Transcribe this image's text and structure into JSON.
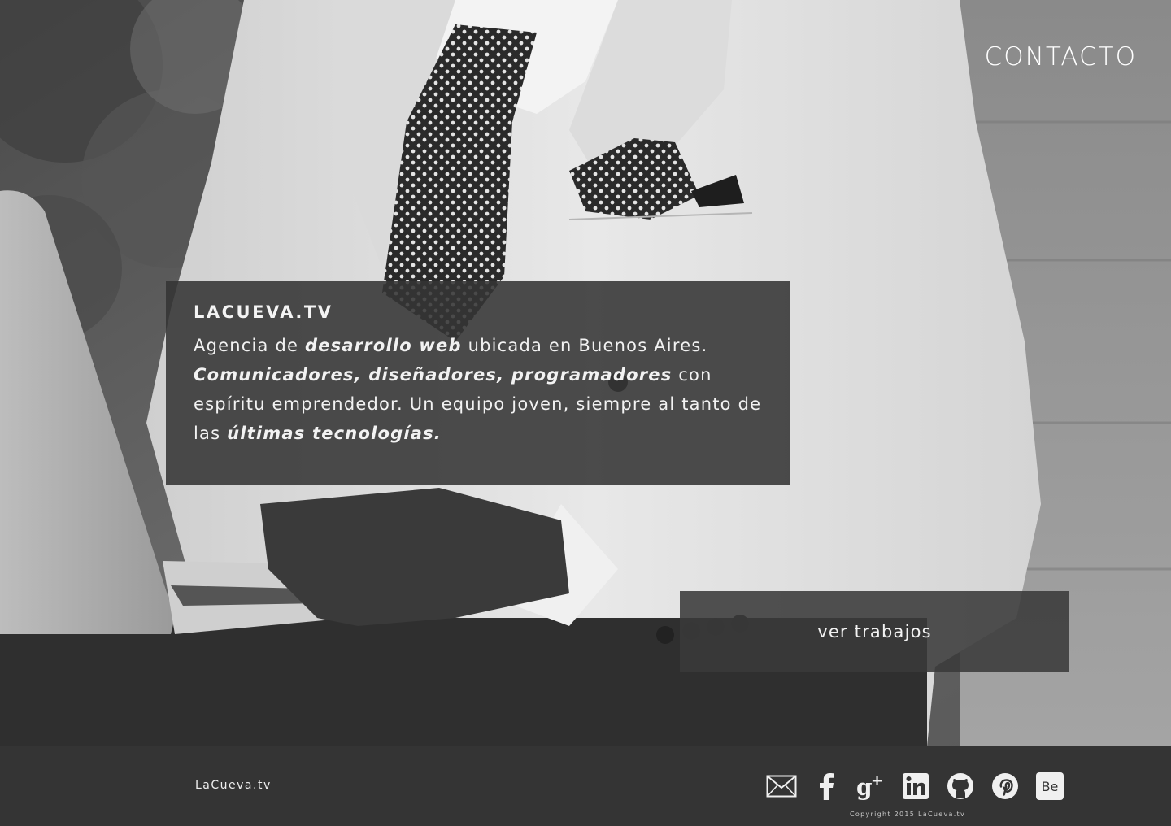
{
  "header": {
    "contact_label": "CONTACTO"
  },
  "about": {
    "brand": "LACUEVA.TV",
    "text_1": "Agencia de ",
    "bold_1": "desarrollo web",
    "text_2": " ubicada en Buenos Aires. ",
    "bold_2": "Comunicadores, diseñadores, programadores",
    "text_3": " con espíritu emprendedor. Un equipo joven, siempre al tanto de las ",
    "bold_3": "últimas tecnologías."
  },
  "cta": {
    "label": "ver trabajos"
  },
  "footer": {
    "brand": "LaCueva.tv",
    "copyright": "Copyright 2015  LaCueva.tv",
    "social": [
      {
        "icon": "mail-icon"
      },
      {
        "icon": "facebook-icon"
      },
      {
        "icon": "google-plus-icon"
      },
      {
        "icon": "linkedin-icon"
      },
      {
        "icon": "github-icon"
      },
      {
        "icon": "pinterest-icon"
      },
      {
        "icon": "behance-icon",
        "text": "Be"
      }
    ]
  },
  "colors": {
    "overlay": "#343434",
    "text": "#f2f2f2",
    "footer_bg": "#343434"
  }
}
